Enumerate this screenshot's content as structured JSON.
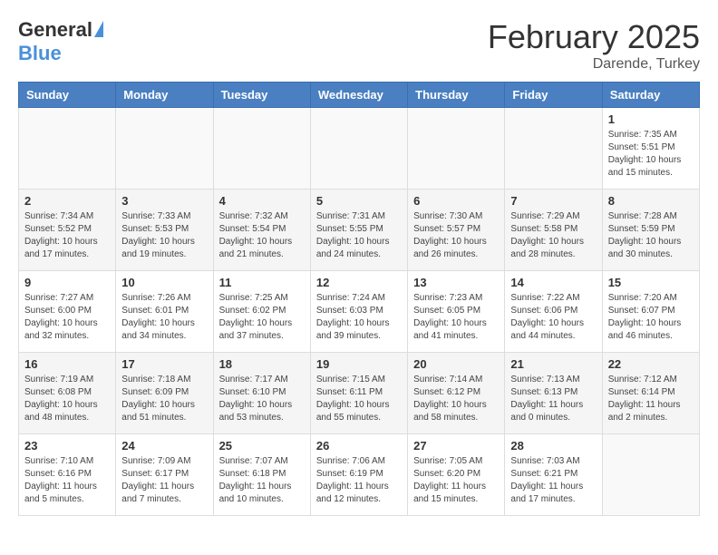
{
  "header": {
    "logo_general": "General",
    "logo_blue": "Blue",
    "title": "February 2025",
    "location": "Darende, Turkey"
  },
  "weekdays": [
    "Sunday",
    "Monday",
    "Tuesday",
    "Wednesday",
    "Thursday",
    "Friday",
    "Saturday"
  ],
  "weeks": [
    [
      {
        "day": "",
        "info": ""
      },
      {
        "day": "",
        "info": ""
      },
      {
        "day": "",
        "info": ""
      },
      {
        "day": "",
        "info": ""
      },
      {
        "day": "",
        "info": ""
      },
      {
        "day": "",
        "info": ""
      },
      {
        "day": "1",
        "info": "Sunrise: 7:35 AM\nSunset: 5:51 PM\nDaylight: 10 hours and 15 minutes."
      }
    ],
    [
      {
        "day": "2",
        "info": "Sunrise: 7:34 AM\nSunset: 5:52 PM\nDaylight: 10 hours and 17 minutes."
      },
      {
        "day": "3",
        "info": "Sunrise: 7:33 AM\nSunset: 5:53 PM\nDaylight: 10 hours and 19 minutes."
      },
      {
        "day": "4",
        "info": "Sunrise: 7:32 AM\nSunset: 5:54 PM\nDaylight: 10 hours and 21 minutes."
      },
      {
        "day": "5",
        "info": "Sunrise: 7:31 AM\nSunset: 5:55 PM\nDaylight: 10 hours and 24 minutes."
      },
      {
        "day": "6",
        "info": "Sunrise: 7:30 AM\nSunset: 5:57 PM\nDaylight: 10 hours and 26 minutes."
      },
      {
        "day": "7",
        "info": "Sunrise: 7:29 AM\nSunset: 5:58 PM\nDaylight: 10 hours and 28 minutes."
      },
      {
        "day": "8",
        "info": "Sunrise: 7:28 AM\nSunset: 5:59 PM\nDaylight: 10 hours and 30 minutes."
      }
    ],
    [
      {
        "day": "9",
        "info": "Sunrise: 7:27 AM\nSunset: 6:00 PM\nDaylight: 10 hours and 32 minutes."
      },
      {
        "day": "10",
        "info": "Sunrise: 7:26 AM\nSunset: 6:01 PM\nDaylight: 10 hours and 34 minutes."
      },
      {
        "day": "11",
        "info": "Sunrise: 7:25 AM\nSunset: 6:02 PM\nDaylight: 10 hours and 37 minutes."
      },
      {
        "day": "12",
        "info": "Sunrise: 7:24 AM\nSunset: 6:03 PM\nDaylight: 10 hours and 39 minutes."
      },
      {
        "day": "13",
        "info": "Sunrise: 7:23 AM\nSunset: 6:05 PM\nDaylight: 10 hours and 41 minutes."
      },
      {
        "day": "14",
        "info": "Sunrise: 7:22 AM\nSunset: 6:06 PM\nDaylight: 10 hours and 44 minutes."
      },
      {
        "day": "15",
        "info": "Sunrise: 7:20 AM\nSunset: 6:07 PM\nDaylight: 10 hours and 46 minutes."
      }
    ],
    [
      {
        "day": "16",
        "info": "Sunrise: 7:19 AM\nSunset: 6:08 PM\nDaylight: 10 hours and 48 minutes."
      },
      {
        "day": "17",
        "info": "Sunrise: 7:18 AM\nSunset: 6:09 PM\nDaylight: 10 hours and 51 minutes."
      },
      {
        "day": "18",
        "info": "Sunrise: 7:17 AM\nSunset: 6:10 PM\nDaylight: 10 hours and 53 minutes."
      },
      {
        "day": "19",
        "info": "Sunrise: 7:15 AM\nSunset: 6:11 PM\nDaylight: 10 hours and 55 minutes."
      },
      {
        "day": "20",
        "info": "Sunrise: 7:14 AM\nSunset: 6:12 PM\nDaylight: 10 hours and 58 minutes."
      },
      {
        "day": "21",
        "info": "Sunrise: 7:13 AM\nSunset: 6:13 PM\nDaylight: 11 hours and 0 minutes."
      },
      {
        "day": "22",
        "info": "Sunrise: 7:12 AM\nSunset: 6:14 PM\nDaylight: 11 hours and 2 minutes."
      }
    ],
    [
      {
        "day": "23",
        "info": "Sunrise: 7:10 AM\nSunset: 6:16 PM\nDaylight: 11 hours and 5 minutes."
      },
      {
        "day": "24",
        "info": "Sunrise: 7:09 AM\nSunset: 6:17 PM\nDaylight: 11 hours and 7 minutes."
      },
      {
        "day": "25",
        "info": "Sunrise: 7:07 AM\nSunset: 6:18 PM\nDaylight: 11 hours and 10 minutes."
      },
      {
        "day": "26",
        "info": "Sunrise: 7:06 AM\nSunset: 6:19 PM\nDaylight: 11 hours and 12 minutes."
      },
      {
        "day": "27",
        "info": "Sunrise: 7:05 AM\nSunset: 6:20 PM\nDaylight: 11 hours and 15 minutes."
      },
      {
        "day": "28",
        "info": "Sunrise: 7:03 AM\nSunset: 6:21 PM\nDaylight: 11 hours and 17 minutes."
      },
      {
        "day": "",
        "info": ""
      }
    ]
  ]
}
